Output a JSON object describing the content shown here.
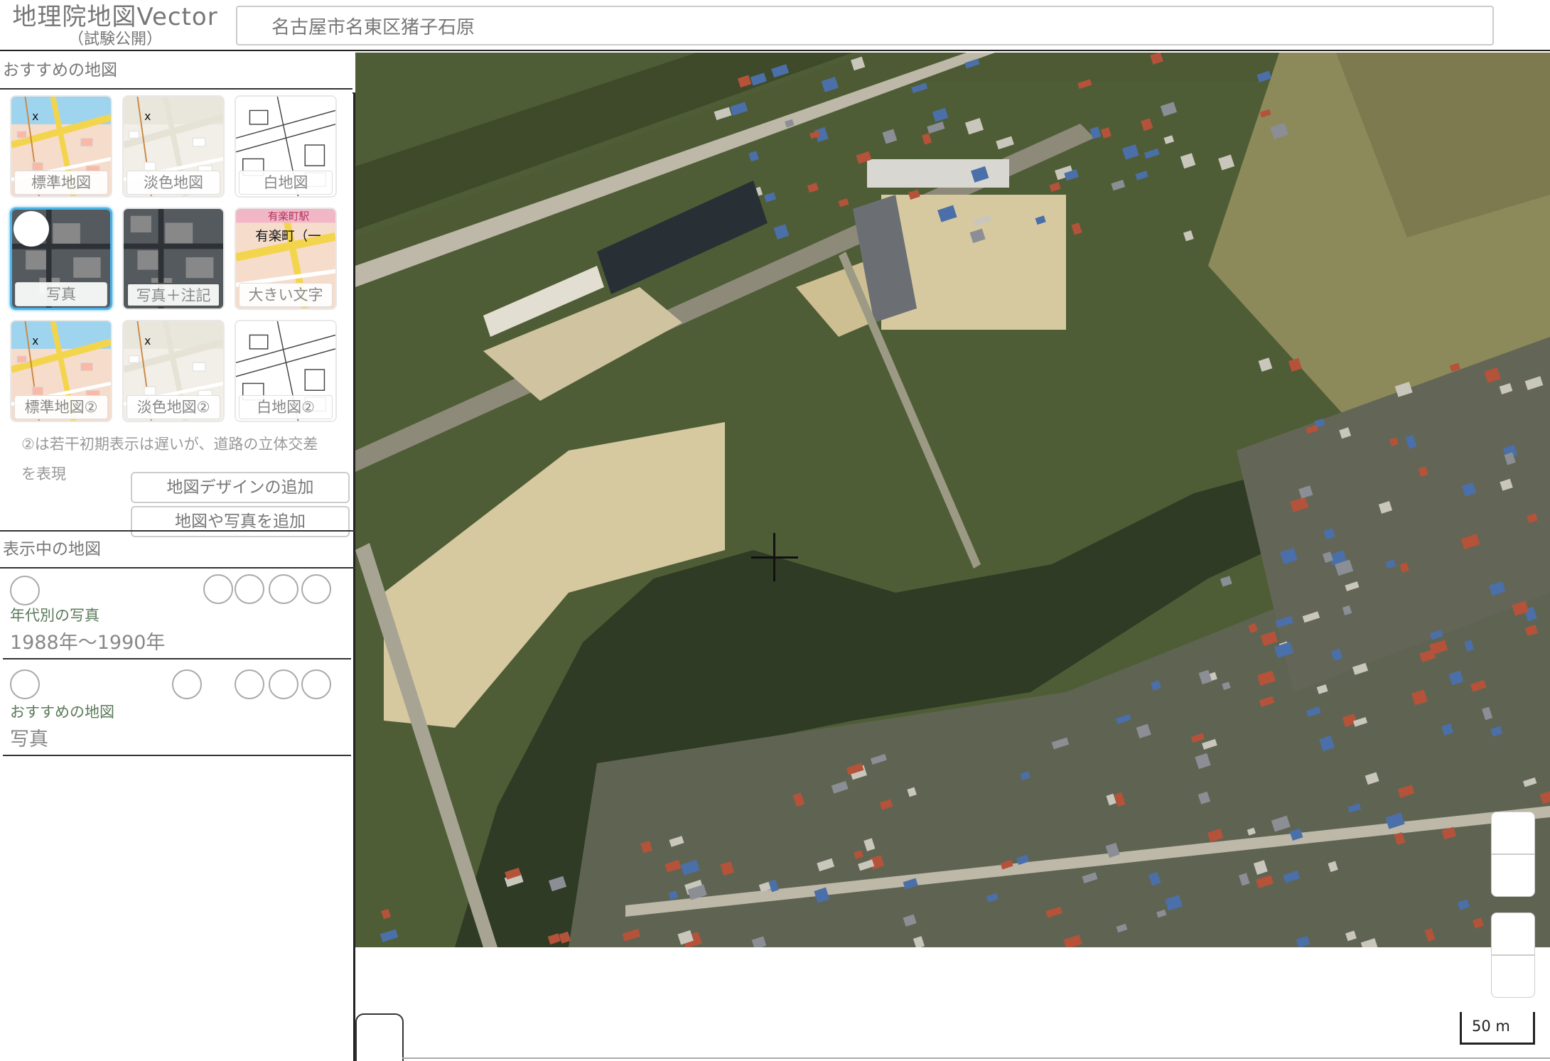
{
  "header": {
    "logo_main": "地理院地図Vector",
    "logo_sub": "（試験公開）",
    "search_value": "名古屋市名東区猪子石原"
  },
  "recommended": {
    "title": "おすすめの地図",
    "tiles": [
      {
        "label": "標準地図",
        "style": "standard",
        "selected": false
      },
      {
        "label": "淡色地図",
        "style": "pale",
        "selected": false
      },
      {
        "label": "白地図",
        "style": "blank",
        "selected": false
      },
      {
        "label": "写真",
        "style": "photo",
        "selected": true
      },
      {
        "label": "写真＋注記",
        "style": "photo",
        "selected": false
      },
      {
        "label": "大きい文字",
        "style": "bigtext",
        "selected": false
      },
      {
        "label": "標準地図②",
        "style": "standard",
        "selected": false
      },
      {
        "label": "淡色地図②",
        "style": "pale",
        "selected": false
      },
      {
        "label": "白地図②",
        "style": "blank",
        "selected": false
      }
    ],
    "tile_map_label": "有楽町（一",
    "tile_map_label_top": "有楽町駅",
    "note_line1": "②は若干初期表示は遅いが、道路の立体交差",
    "note_line2": "を表現",
    "add_design_button": "地図デザインの追加",
    "add_map_button": "地図や写真を追加"
  },
  "displayed": {
    "title": "表示中の地図",
    "layers": [
      {
        "category": "年代別の写真",
        "name": "1988年〜1990年"
      },
      {
        "category": "おすすめの地図",
        "name": "写真"
      }
    ]
  },
  "map": {
    "scale_label": "50 m",
    "colors": {
      "vegetation": "#4f5d36",
      "field": "#8c8a5a",
      "sand": "#d6c9a0",
      "road": "#bdb8a8",
      "roof_blue": "#4b6fa8",
      "roof_red": "#b5523a",
      "forest": "#2f3b24"
    }
  }
}
